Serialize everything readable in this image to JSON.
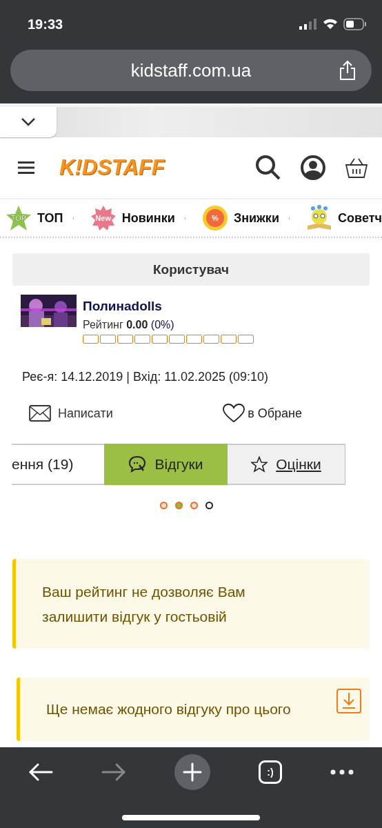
{
  "status_bar": {
    "time": "19:33"
  },
  "browser": {
    "url": "kidstaff.com.ua",
    "tab_label": ":)"
  },
  "header": {
    "logo": "K!DSTAFF"
  },
  "nav": [
    {
      "label": "ТОП",
      "badge": "TOP",
      "kind": "star"
    },
    {
      "label": "Новинки",
      "badge": "New",
      "kind": "burst"
    },
    {
      "label": "Знижки",
      "badge": "%",
      "kind": "medal"
    },
    {
      "label": "Советч",
      "kind": "book"
    }
  ],
  "user": {
    "heading": "Користувач",
    "name": "Полинаdolls",
    "rating_label": "Рейтинг",
    "rating_value": "0.00",
    "rating_percent": "(0%)",
    "dates": "Реє-я: 14.12.2019 | Вхід: 11.02.2025 (09:10)",
    "actions": [
      {
        "label": "Написати",
        "kind": "mail"
      },
      {
        "label": "в Обране",
        "kind": "heart"
      }
    ]
  },
  "tabs": [
    {
      "label": "ення (19)",
      "selected": false,
      "kind": "plain"
    },
    {
      "label": "Відгуки",
      "selected": true,
      "kind": "comment"
    },
    {
      "label": "Оцінки",
      "selected": false,
      "kind": "star"
    }
  ],
  "dots": [
    {
      "selected": false,
      "color": "#f26c1c"
    },
    {
      "selected": true,
      "color": "#f26c1c"
    },
    {
      "selected": false,
      "color": "#f26c1c"
    },
    {
      "selected": false,
      "color": "#222222"
    }
  ],
  "notices": [
    {
      "text": "Ваш рейтинг не дозволяє Вам залишити відгук у гостьовій",
      "kind": "plain"
    },
    {
      "text": "Ще немає жодного відгуку про цього",
      "kind": "download"
    }
  ]
}
